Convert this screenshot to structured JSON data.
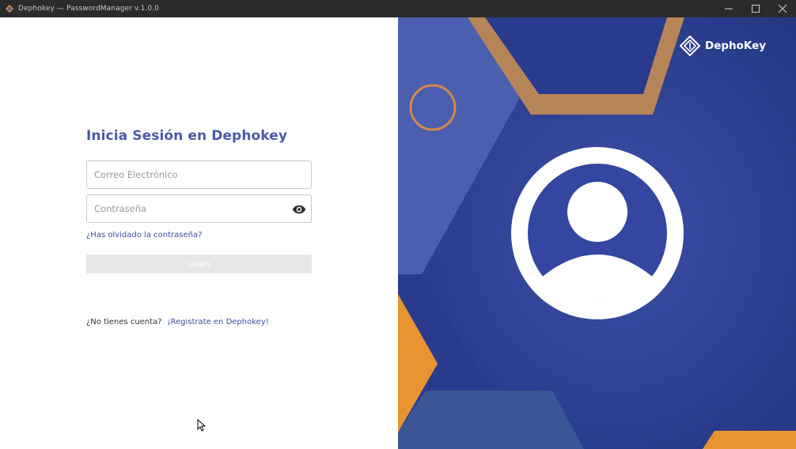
{
  "window": {
    "title": "Dephokey — PasswordManager v.1.0.0",
    "icon": "diamond-logo-icon",
    "controls": [
      "minimize-icon",
      "maximize-icon",
      "close-icon"
    ]
  },
  "login": {
    "heading": "Inicia Sesión en Dephokey",
    "email_placeholder": "Correo Electrónico",
    "email_value": "",
    "password_placeholder": "Contraseña",
    "password_value": "",
    "forgot_password": "¿Has olvidado la contraseña?",
    "login_button": "Login",
    "signup_prompt": "¿No tienes cuenta?",
    "signup_link": "¡Registrate en Dephokey!"
  },
  "brand": {
    "name": "DephoKey",
    "icon": "dephokey-logo-icon"
  },
  "colors": {
    "accent": "#4a59a7",
    "link": "#3c4f9e",
    "panel_blue": "#2f3f95",
    "hex_brown": "#b68557",
    "orange": "#e89430",
    "titlebar": "#2b2b2b"
  }
}
